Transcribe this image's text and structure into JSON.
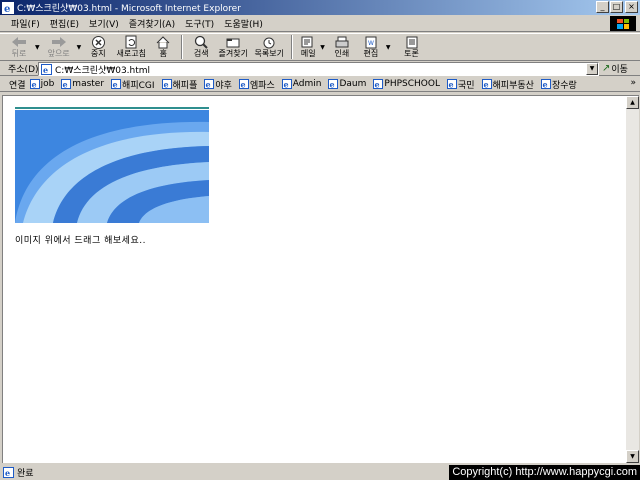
{
  "window": {
    "title": "C:₩스크린샷₩03.html - Microsoft Internet Explorer",
    "minimize": "_",
    "maximize": "□",
    "close": "×"
  },
  "menu": [
    {
      "label": "파일(F)"
    },
    {
      "label": "편집(E)"
    },
    {
      "label": "보기(V)"
    },
    {
      "label": "즐겨찾기(A)"
    },
    {
      "label": "도구(T)"
    },
    {
      "label": "도움말(H)"
    }
  ],
  "toolbar": {
    "back": {
      "label": "뒤로",
      "icon": "arrow-left-icon"
    },
    "forward": {
      "label": "앞으로",
      "icon": "arrow-right-icon"
    },
    "stop": {
      "label": "중지",
      "icon": "stop-icon"
    },
    "refresh": {
      "label": "새로고침",
      "icon": "refresh-icon"
    },
    "home": {
      "label": "홈",
      "icon": "home-icon"
    },
    "search": {
      "label": "검색",
      "icon": "search-icon"
    },
    "favorites": {
      "label": "즐겨찾기",
      "icon": "favorites-icon"
    },
    "history": {
      "label": "목록보기",
      "icon": "history-icon"
    },
    "mail": {
      "label": "메일",
      "icon": "mail-icon"
    },
    "print": {
      "label": "인쇄",
      "icon": "print-icon"
    },
    "edit": {
      "label": "편집",
      "icon": "edit-icon"
    },
    "discuss": {
      "label": "토론",
      "icon": "discuss-icon"
    }
  },
  "address": {
    "label": "주소(D)",
    "value": "C:₩스크린샷₩03.html",
    "go_label": "이동"
  },
  "links": {
    "label": "연결",
    "items": [
      {
        "label": "job"
      },
      {
        "label": "master"
      },
      {
        "label": "해피CGI"
      },
      {
        "label": "해피플"
      },
      {
        "label": "야후"
      },
      {
        "label": "엠파스"
      },
      {
        "label": "Admin"
      },
      {
        "label": "Daum"
      },
      {
        "label": "PHPSCHOOL"
      },
      {
        "label": "국민"
      },
      {
        "label": "해피부동산"
      },
      {
        "label": "장수랑"
      }
    ],
    "more": "»"
  },
  "content": {
    "caption": "이미지 위에서 드래그 해보세요.."
  },
  "status": {
    "text": "완료",
    "copyright": "Copyright(c) http://www.happycgi.com"
  },
  "colors": {
    "titlebar_start": "#0a246a",
    "titlebar_end": "#a6caf0",
    "chrome": "#d4d0c8",
    "banner_dark": "#3a7bd5",
    "banner_light": "#9ccaf5"
  }
}
